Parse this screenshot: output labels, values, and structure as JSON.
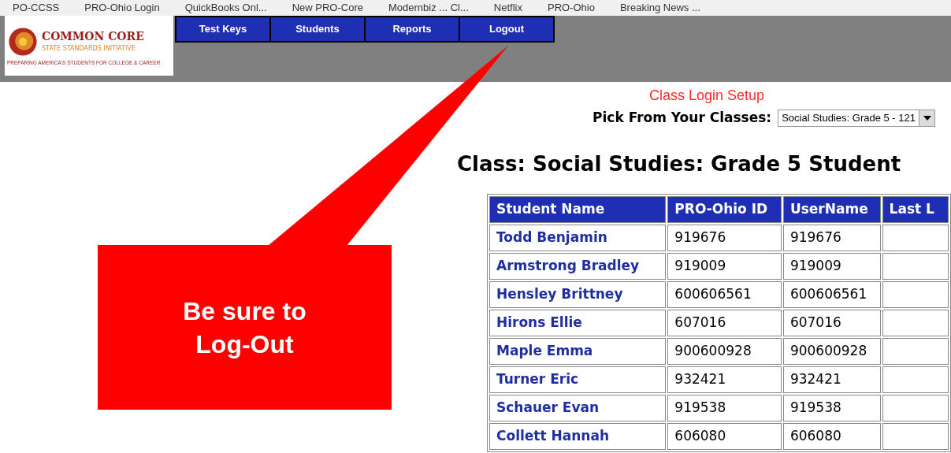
{
  "bookmarks": [
    "PO-CCSS",
    "PRO-Ohio Login",
    "QuickBooks Onl...",
    "New PRO-Core",
    "Modernbiz ... Cl...",
    "Netflix",
    "PRO-Ohio",
    "Breaking News ..."
  ],
  "logo": {
    "title": "COMMON CORE",
    "subtitle": "STATE STANDARDS INITIATIVE",
    "tagline": "PREPARING AMERICA'S STUDENTS FOR COLLEGE & CAREER"
  },
  "nav": [
    "Test Keys",
    "Students",
    "Reports",
    "Logout"
  ],
  "page_title": "Class Login Setup",
  "class_picker": {
    "label": "Pick From Your Classes:",
    "value": "Social Studies: Grade 5 - 121"
  },
  "heading": "Class: Social Studies: Grade 5 Student",
  "table": {
    "columns": [
      "Student Name",
      "PRO-Ohio ID",
      "UserName",
      "Last L"
    ],
    "rows": [
      [
        "Todd Benjamin",
        "919676",
        "919676",
        ""
      ],
      [
        "Armstrong Bradley",
        "919009",
        "919009",
        ""
      ],
      [
        "Hensley Brittney",
        "600606561",
        "600606561",
        ""
      ],
      [
        "Hirons Ellie",
        "607016",
        "607016",
        ""
      ],
      [
        "Maple Emma",
        "900600928",
        "900600928",
        ""
      ],
      [
        "Turner Eric",
        "932421",
        "932421",
        ""
      ],
      [
        "Schauer Evan",
        "919538",
        "919538",
        ""
      ],
      [
        "Collett Hannah",
        "606080",
        "606080",
        ""
      ]
    ]
  },
  "callout": "Be sure to Log-Out"
}
